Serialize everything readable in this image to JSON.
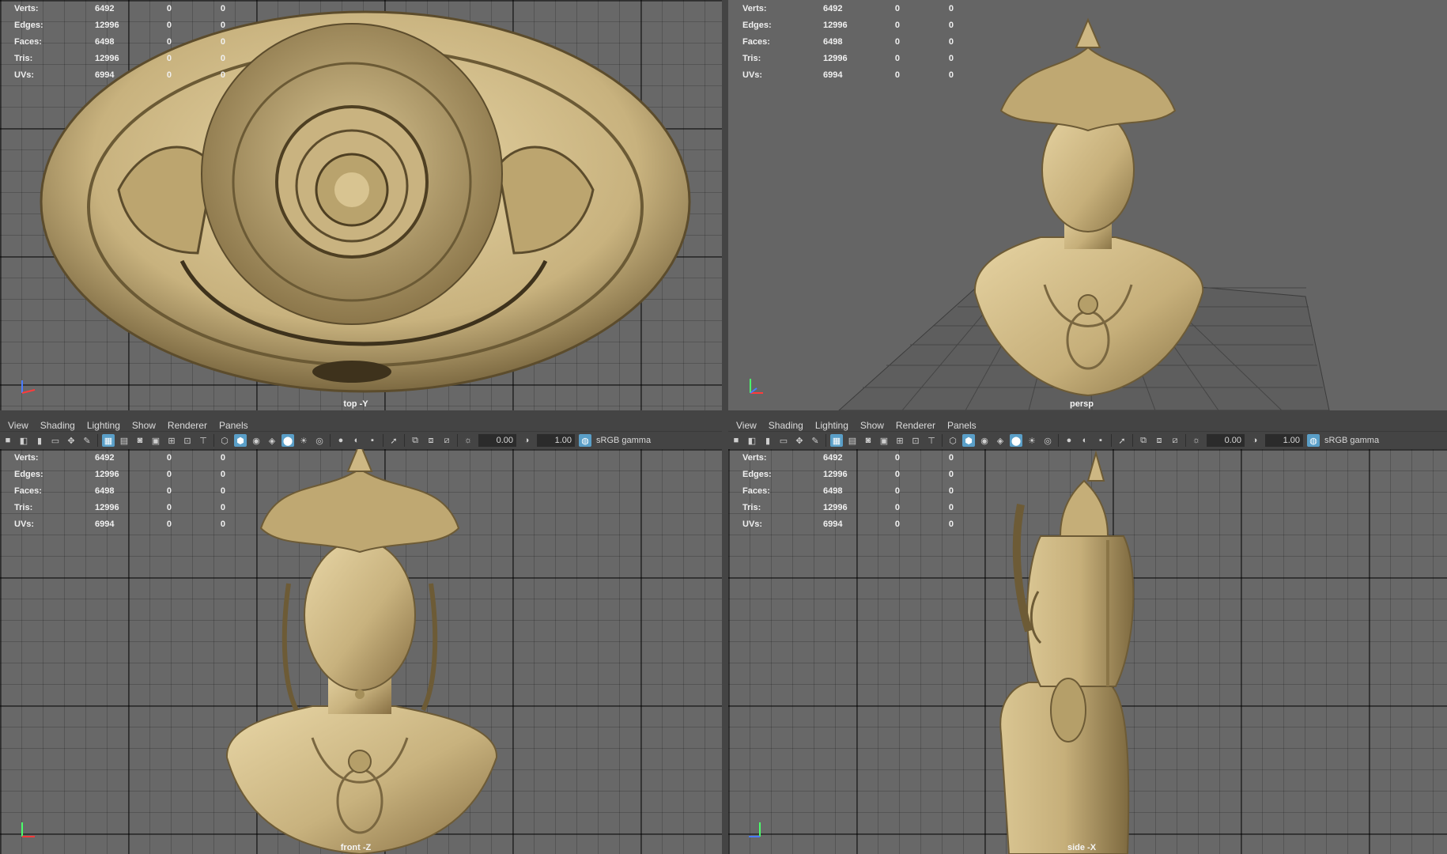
{
  "stats": {
    "rows": [
      {
        "label": "Verts:",
        "v1": "6492",
        "v2": "0",
        "v3": "0"
      },
      {
        "label": "Edges:",
        "v1": "12996",
        "v2": "0",
        "v3": "0"
      },
      {
        "label": "Faces:",
        "v1": "6498",
        "v2": "0",
        "v3": "0"
      },
      {
        "label": "Tris:",
        "v1": "12996",
        "v2": "0",
        "v3": "0"
      },
      {
        "label": "UVs:",
        "v1": "6994",
        "v2": "0",
        "v3": "0"
      }
    ]
  },
  "menu": {
    "view": "View",
    "shading": "Shading",
    "lighting": "Lighting",
    "show": "Show",
    "renderer": "Renderer",
    "panels": "Panels"
  },
  "toolbar": {
    "field1": "0.00",
    "field2": "1.00",
    "colorspace": "sRGB gamma"
  },
  "cameras": {
    "top": "top -Y",
    "persp": "persp",
    "front": "front -Z",
    "side": "side -X"
  },
  "colors": {
    "viewport_bg": "#686868",
    "grid": "#555555",
    "model": "#c8b27e",
    "active_icon": "#5a9fc8"
  }
}
